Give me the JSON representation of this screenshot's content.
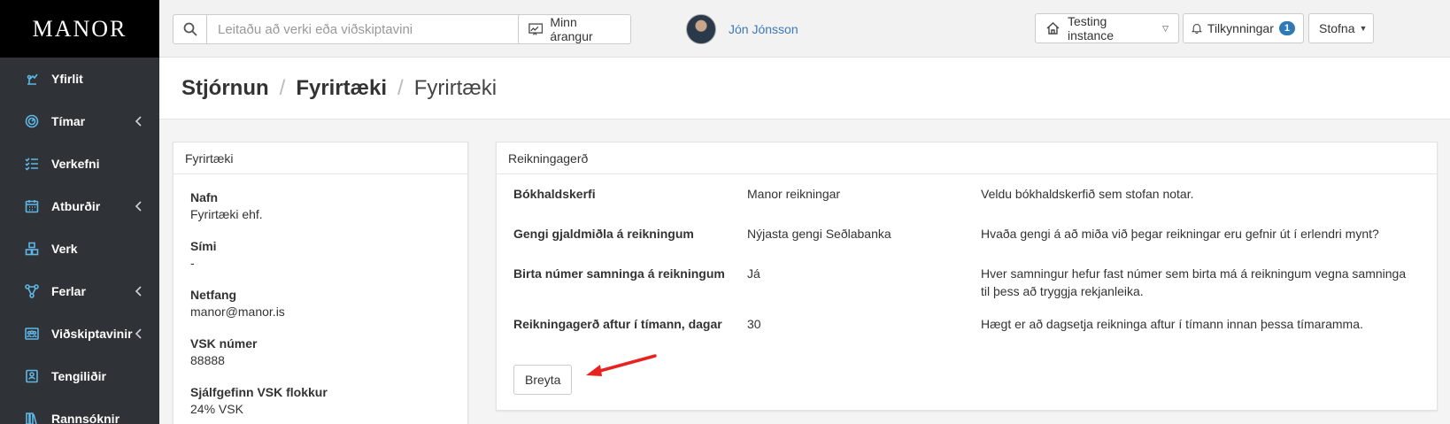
{
  "sidebar": {
    "logo": "MANOR",
    "items": [
      {
        "label": "Yfirlit",
        "icon": "overview-icon",
        "chevron": false
      },
      {
        "label": "Tímar",
        "icon": "clock-icon",
        "chevron": true
      },
      {
        "label": "Verkefni",
        "icon": "tasks-icon",
        "chevron": false
      },
      {
        "label": "Atburðir",
        "icon": "calendar-icon",
        "chevron": true
      },
      {
        "label": "Verk",
        "icon": "boxes-icon",
        "chevron": false
      },
      {
        "label": "Ferlar",
        "icon": "workflow-icon",
        "chevron": true
      },
      {
        "label": "Viðskiptavinir",
        "icon": "customers-icon",
        "chevron": true
      },
      {
        "label": "Tengiliðir",
        "icon": "contact-icon",
        "chevron": false
      },
      {
        "label": "Rannsóknir",
        "icon": "research-icon",
        "chevron": false
      }
    ]
  },
  "topbar": {
    "search_placeholder": "Leitaðu að verki eða viðskiptavini",
    "results_button": "Minn árangur",
    "user_name": "Jón Jónsson",
    "instance_button": "Testing instance",
    "notifications_label": "Tilkynningar",
    "notifications_count": "1",
    "create_button": "Stofna"
  },
  "breadcrumb": {
    "part1": "Stjórnun",
    "part2": "Fyrirtæki",
    "part3": "Fyrirtæki",
    "separator": "/"
  },
  "company_panel": {
    "title": "Fyrirtæki",
    "fields": [
      {
        "label": "Nafn",
        "value": "Fyrirtæki ehf."
      },
      {
        "label": "Sími",
        "value": "-"
      },
      {
        "label": "Netfang",
        "value": "manor@manor.is"
      },
      {
        "label": "VSK númer",
        "value": "88888"
      },
      {
        "label": "Sjálfgefinn VSK flokkur",
        "value": "24% VSK"
      }
    ]
  },
  "invoicing_panel": {
    "title": "Reikningagerð",
    "rows": [
      {
        "label": "Bókhaldskerfi",
        "value": "Manor reikningar",
        "description": "Veldu bókhaldskerfið sem stofan notar."
      },
      {
        "label": "Gengi gjaldmiðla á reikningum",
        "value": "Nýjasta gengi Seðlabanka",
        "description": "Hvaða gengi á að miða við þegar reikningar eru gefnir út í erlendri mynt?"
      },
      {
        "label": "Birta númer samninga á reikningum",
        "value": "Já",
        "description": "Hver samningur hefur fast númer sem birta má á reikningum vegna samninga til þess að tryggja rekjanleika."
      },
      {
        "label": "Reikningagerð aftur í tímann, dagar",
        "value": "30",
        "description": "Hægt er að dagsetja reikninga aftur í tímann innan þessa tímaramma."
      }
    ],
    "edit_button": "Breyta"
  },
  "colors": {
    "sidebar_bg": "#2f3236",
    "accent_blue": "#3a7ab8",
    "icon_blue": "#5fb7e5",
    "annotation_arrow": "#e8231f"
  }
}
